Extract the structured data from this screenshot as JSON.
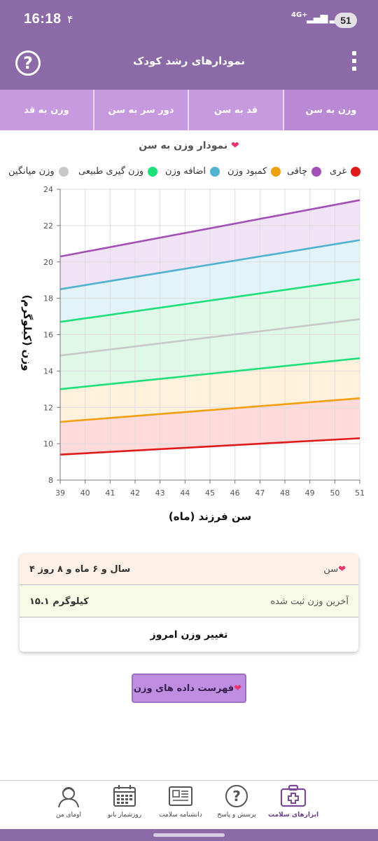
{
  "status": {
    "time": "16:18",
    "notif": "۴",
    "network": "4G+",
    "battery": "51"
  },
  "app": {
    "title": "نمودارهای رشد کودک"
  },
  "tabs": [
    {
      "label": "وزن به سن",
      "active": true
    },
    {
      "label": "قد به سن",
      "active": false
    },
    {
      "label": "دور سر به سن",
      "active": false
    },
    {
      "label": "وزن به قد",
      "active": false
    }
  ],
  "chart": {
    "title": "نمودار وزن به سن",
    "legend": [
      {
        "label": "غری",
        "color": "#e01a1a"
      },
      {
        "label": "چاقی",
        "color": "#a24fb6"
      },
      {
        "label": "کمبود وزن",
        "color": "#f0a010"
      },
      {
        "label": "اضافه وزن",
        "color": "#4fb2d0"
      },
      {
        "label": "وزن گیری طبیعی",
        "color": "#1ee07a"
      },
      {
        "label": "وزن میانگین",
        "color": "#c8c8c8"
      }
    ]
  },
  "chart_data": {
    "type": "area",
    "title": "نمودار وزن به سن",
    "xlabel": "سن فرزند (ماه)",
    "ylabel": "وزن (کیلوگرم)",
    "x": [
      39,
      40,
      41,
      42,
      43,
      44,
      45,
      46,
      47,
      48,
      49,
      50,
      51
    ],
    "xlim": [
      39,
      51
    ],
    "ylim": [
      8,
      24
    ],
    "yticks": [
      8,
      10,
      12,
      14,
      16,
      18,
      20,
      22,
      24
    ],
    "grid": true,
    "legend_position": "top",
    "series": [
      {
        "name": "غری",
        "color": "#e01a1a",
        "start": 9.4,
        "end": 10.3
      },
      {
        "name": "کمبود وزن",
        "color": "#f0a010",
        "start": 11.2,
        "end": 12.5
      },
      {
        "name": "وزن گیری طبیعی",
        "color": "#1ee07a",
        "start": 13.0,
        "end": 14.7
      },
      {
        "name": "وزن میانگین",
        "color": "#c8c8c8",
        "start": 14.85,
        "end": 16.85
      },
      {
        "name": "وزن گیری طبیعی",
        "color": "#1ee07a",
        "start": 16.7,
        "end": 19.05
      },
      {
        "name": "اضافه وزن",
        "color": "#4fb2d0",
        "start": 18.5,
        "end": 21.2
      },
      {
        "name": "چاقی",
        "color": "#a24fb6",
        "start": 20.3,
        "end": 23.4
      }
    ],
    "bands": [
      {
        "from": 0,
        "to": 1,
        "color": "#ffd6d6"
      },
      {
        "from": 1,
        "to": 2,
        "color": "#ffefd8"
      },
      {
        "from": 2,
        "to": 4,
        "color": "#dcf7e6"
      },
      {
        "from": 4,
        "to": 5,
        "color": "#dff2f8"
      },
      {
        "from": 5,
        "to": 6,
        "color": "#f0e0f5"
      }
    ]
  },
  "card": {
    "age_label": "سن",
    "age_value": "۴ سال و ۶ ماه و ۸ روز",
    "weight_label": "آخرین وزن ثبت شده",
    "weight_value": "۱۵.۱ کیلوگرم",
    "change_label": "تغییر وزن امروز"
  },
  "list_button": "فهرست داده های وزن",
  "nav": [
    {
      "label": "ابزارهای سلامت",
      "icon": "medical-kit-icon",
      "active": true
    },
    {
      "label": "پرسش و پاسخ",
      "icon": "question-icon",
      "active": false
    },
    {
      "label": "دانشنامه سلامت",
      "icon": "newspaper-icon",
      "active": false
    },
    {
      "label": "روزشمار بانو",
      "icon": "calendar-icon",
      "active": false
    },
    {
      "label": "اومای من",
      "icon": "profile-icon",
      "active": false
    }
  ]
}
